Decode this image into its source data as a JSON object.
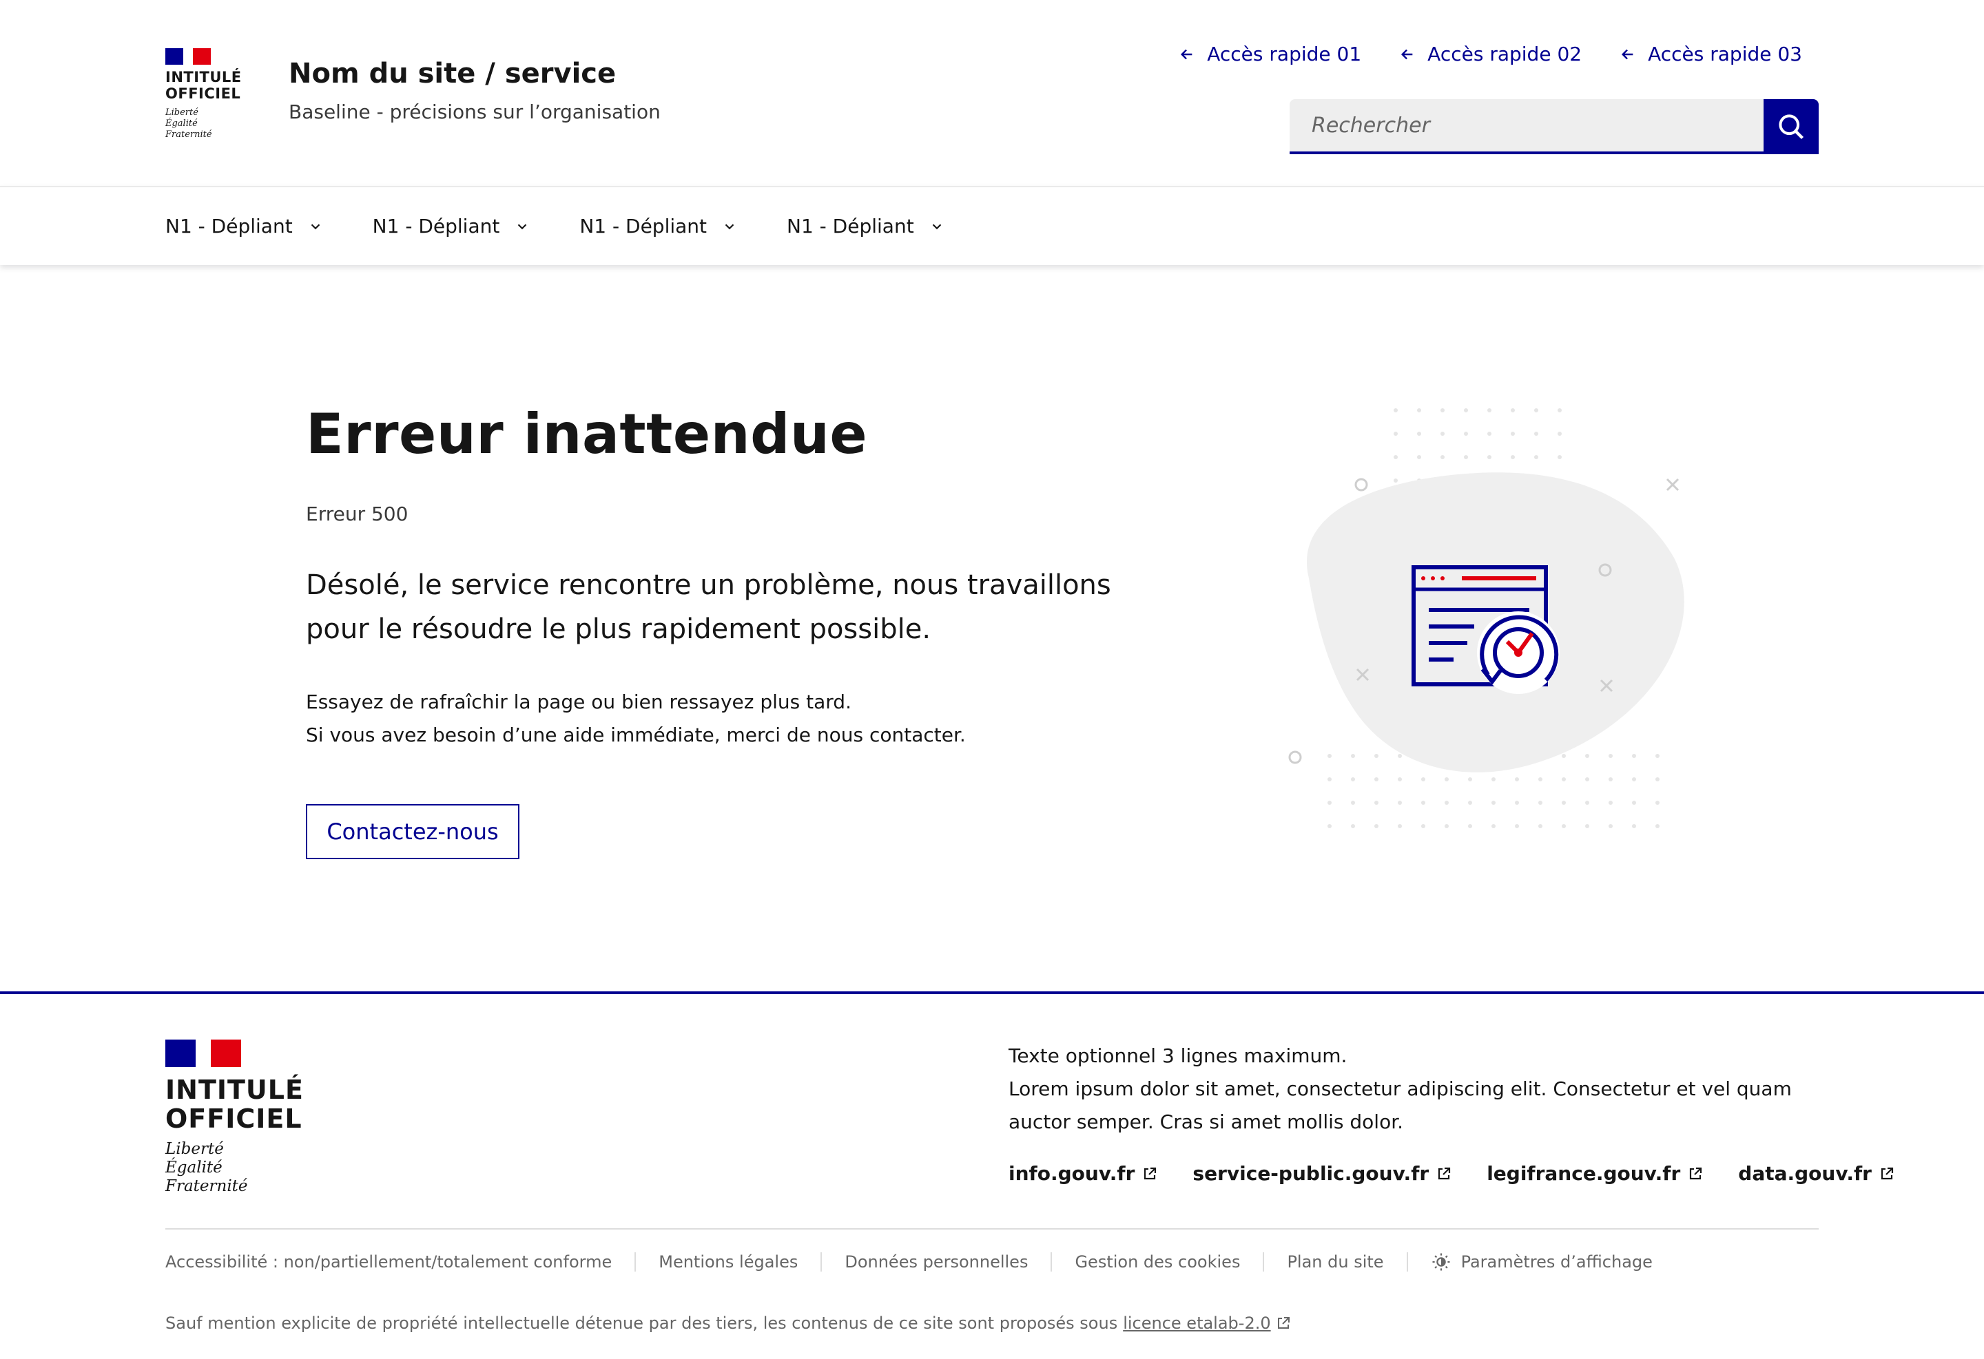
{
  "colors": {
    "primary": "#000091",
    "accent_red": "#e1000f",
    "text": "#161616",
    "muted": "#666666"
  },
  "header": {
    "logo_title": "INTITULÉ\nOFFICIEL",
    "logo_motto": "Liberté\nÉgalité\nFraternité",
    "site_name": "Nom du site / service",
    "baseline": "Baseline - précisions sur l’organisation",
    "quick_links": [
      {
        "label": "Accès rapide 01",
        "icon": "arrow-left-icon"
      },
      {
        "label": "Accès rapide 02",
        "icon": "arrow-left-icon"
      },
      {
        "label": "Accès rapide 03",
        "icon": "arrow-left-icon"
      }
    ],
    "search": {
      "placeholder": "Rechercher",
      "icon": "search-icon"
    }
  },
  "nav": {
    "items": [
      {
        "label": "N1 - Dépliant",
        "icon": "chevron-down-icon"
      },
      {
        "label": "N1 - Dépliant",
        "icon": "chevron-down-icon"
      },
      {
        "label": "N1 - Dépliant",
        "icon": "chevron-down-icon"
      },
      {
        "label": "N1 - Dépliant",
        "icon": "chevron-down-icon"
      }
    ]
  },
  "main": {
    "title": "Erreur inattendue",
    "error_code": "Erreur 500",
    "lead": "Désolé, le service rencontre un problème, nous travaillons pour le résoudre le plus rapidement possible.",
    "body_line1": "Essayez de rafraîchir la page ou bien ressayez plus tard.",
    "body_line2": "Si vous avez besoin d’une aide immédiate, merci de nous contacter.",
    "contact_button": "Contactez-nous",
    "illustration_icon": "technical-error-icon"
  },
  "footer": {
    "logo_title": "INTITULÉ\nOFFICIEL",
    "logo_motto": "Liberté\nÉgalité\nFraternité",
    "desc_line1": "Texte optionnel 3 lignes maximum.",
    "desc_line2": "Lorem ipsum dolor sit amet, consectetur adipiscing elit. Consectetur et vel quam auctor semper. Cras si amet mollis dolor.",
    "links": [
      {
        "label": "info.gouv.fr",
        "icon": "external-link-icon"
      },
      {
        "label": "service-public.gouv.fr",
        "icon": "external-link-icon"
      },
      {
        "label": "legifrance.gouv.fr",
        "icon": "external-link-icon"
      },
      {
        "label": "data.gouv.fr",
        "icon": "external-link-icon"
      }
    ],
    "bottom_links": [
      "Accessibilité : non/partiellement/totalement conforme",
      "Mentions légales",
      "Données personnelles",
      "Gestion des cookies",
      "Plan du site",
      "Paramètres d’affichage"
    ],
    "license_text": "Sauf mention explicite de propriété intellectuelle détenue par des tiers, les contenus de ce site sont proposés sous",
    "license_link": "licence etalab-2.0"
  }
}
